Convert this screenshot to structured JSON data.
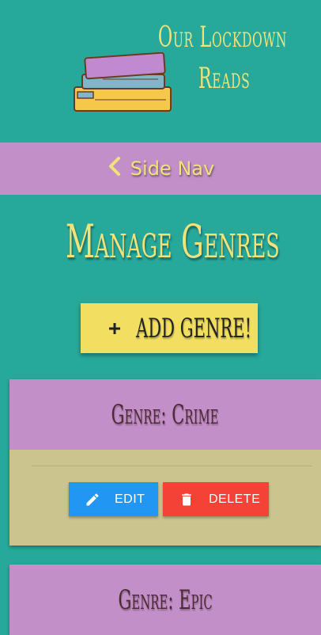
{
  "brand": {
    "line1": "Our Lockdown",
    "line2": "Reads"
  },
  "nav": {
    "chevron_icon": "chevron-left-icon",
    "label": "Side Nav"
  },
  "page": {
    "title": "Manage Genres"
  },
  "add_button": {
    "icon": "plus-icon",
    "label": "ADD GENRE!"
  },
  "genres": [
    {
      "heading": "Genre: Crime",
      "edit_label": "EDIT",
      "delete_label": "DELETE"
    },
    {
      "heading": "Genre: Epic"
    }
  ],
  "colors": {
    "background": "#26a89a",
    "accent_purple": "#c38fc8",
    "accent_yellow": "#f1e27a",
    "button_yellow": "#f2df61",
    "card_body": "#cbc48f",
    "edit_blue": "#2196f3",
    "delete_red": "#f44336"
  }
}
